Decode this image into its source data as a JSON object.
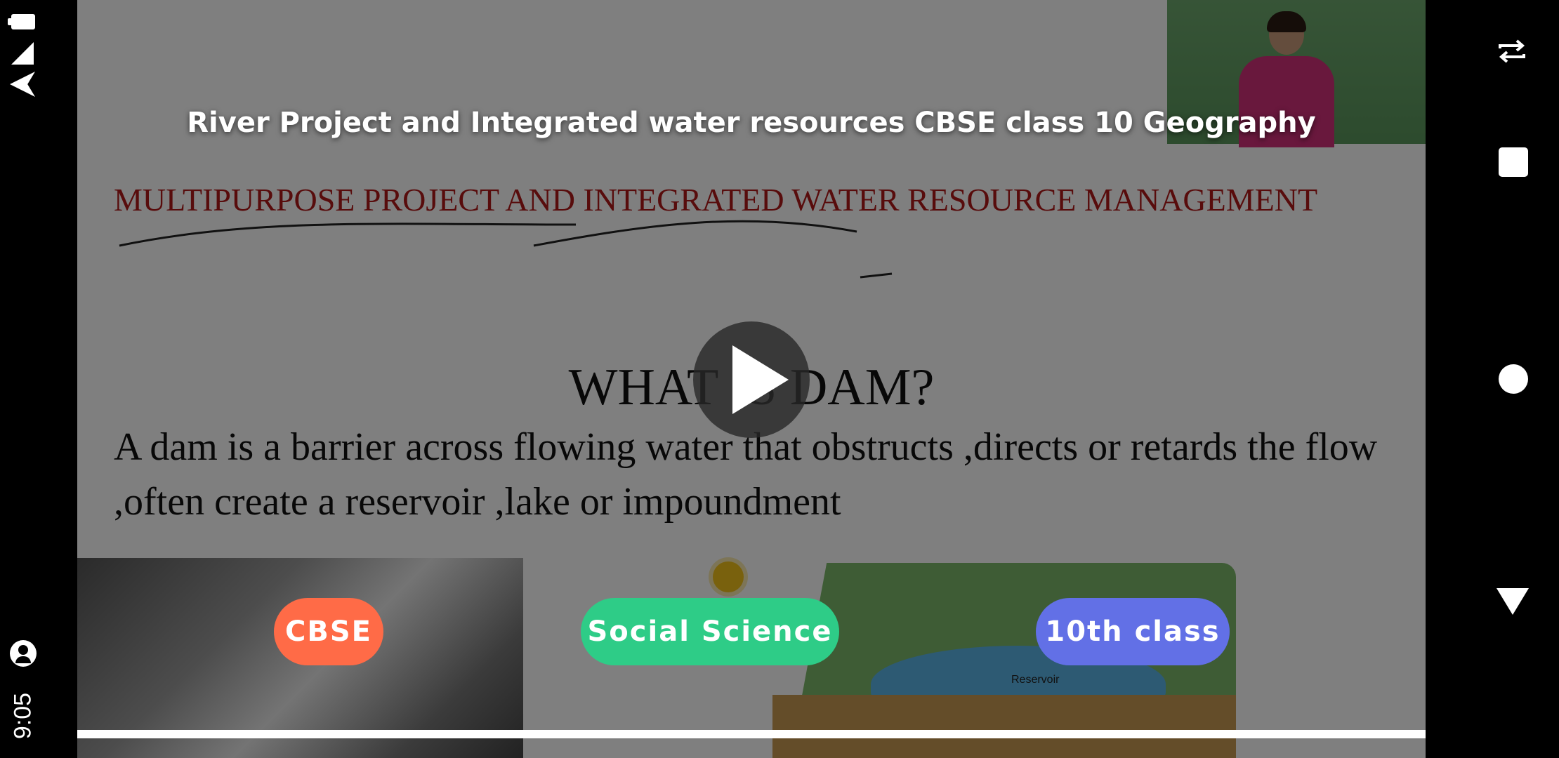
{
  "status_bar": {
    "time": "9:05",
    "icons": [
      "battery-icon",
      "signal-icon",
      "wifi-icon",
      "account-icon"
    ]
  },
  "video": {
    "title": "River Project and Integrated water resources CBSE class 10 Geography",
    "slide": {
      "heading": "MULTIPURPOSE PROJECT AND INTEGRATED WATER RESOURCE MANAGEMENT",
      "question": "WHAT IS DAM?",
      "definition": "A dam is a barrier across flowing water that obstructs ,directs or retards the flow ,often create a reservoir ,lake or impoundment",
      "diagram_label": "Reservoir"
    },
    "tags": [
      {
        "label": "CBSE",
        "color": "#ff6b47"
      },
      {
        "label": "Social Science",
        "color": "#2ecc87"
      },
      {
        "label": "10th class",
        "color": "#6270e6"
      }
    ],
    "play_icon": "play-icon"
  },
  "nav_bar": {
    "icons": [
      "rotate-icon",
      "square-icon",
      "home-circle-icon",
      "back-triangle-icon"
    ]
  }
}
